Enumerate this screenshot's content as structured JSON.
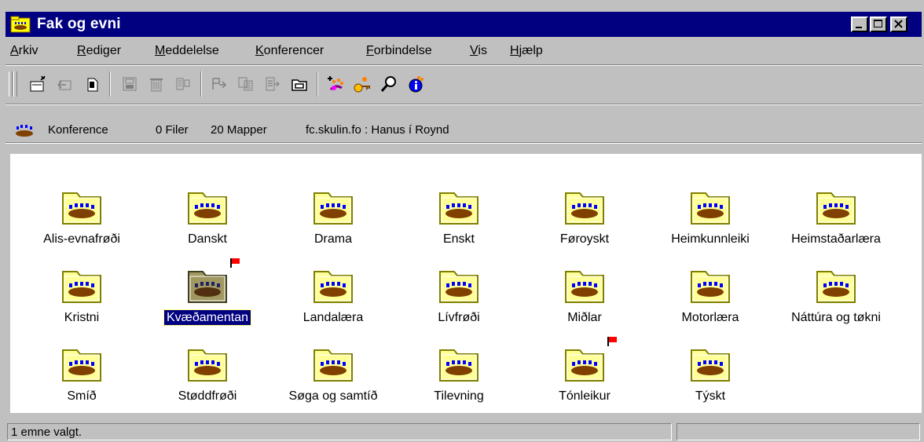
{
  "window": {
    "title": "Fak og evni"
  },
  "menu": [
    {
      "label": "Arkiv",
      "accel": "A",
      "rest": "rkiv"
    },
    {
      "label": "Rediger",
      "accel": "R",
      "rest": "ediger"
    },
    {
      "label": "Meddelelse",
      "accel": "M",
      "rest": "eddelelse"
    },
    {
      "label": "Konferencer",
      "accel": "K",
      "rest": "onferencer"
    },
    {
      "label": "Forbindelse",
      "accel": "F",
      "rest": "orbindelse"
    },
    {
      "label": "Vis",
      "accel": "V",
      "rest": "is"
    },
    {
      "label": "Hjælp",
      "accel": "H",
      "rest": "jælp"
    }
  ],
  "address": {
    "icon": "conference-icon",
    "type": "Konference",
    "files": "0 Filer",
    "folders": "20 Mapper",
    "location": "fc.skulin.fo : Hanus í Roynd"
  },
  "folders": [
    {
      "label": "Alis-evnafrøði"
    },
    {
      "label": "Danskt"
    },
    {
      "label": "Drama"
    },
    {
      "label": "Enskt"
    },
    {
      "label": "Føroyskt"
    },
    {
      "label": "Heimkunnleiki"
    },
    {
      "label": "Heimstaðarlæra"
    },
    {
      "label": "Kristni"
    },
    {
      "label": "Kvæðamentan",
      "selected": true,
      "flag": true
    },
    {
      "label": "Landalæra"
    },
    {
      "label": "Lívfrøði"
    },
    {
      "label": "Miðlar"
    },
    {
      "label": "Motorlæra"
    },
    {
      "label": "Náttúra og tøkni"
    },
    {
      "label": "Smíð"
    },
    {
      "label": "Støddfrøði"
    },
    {
      "label": "Søga og samtíð"
    },
    {
      "label": "Tilevning"
    },
    {
      "label": "Tónleikur",
      "flag": true
    },
    {
      "label": "Týskt"
    }
  ],
  "status": {
    "text": "1 emne valgt."
  },
  "colors": {
    "titlebar": "#000080",
    "face": "#c0c0c0",
    "selection": "#000080",
    "flag": "#ff0000"
  }
}
